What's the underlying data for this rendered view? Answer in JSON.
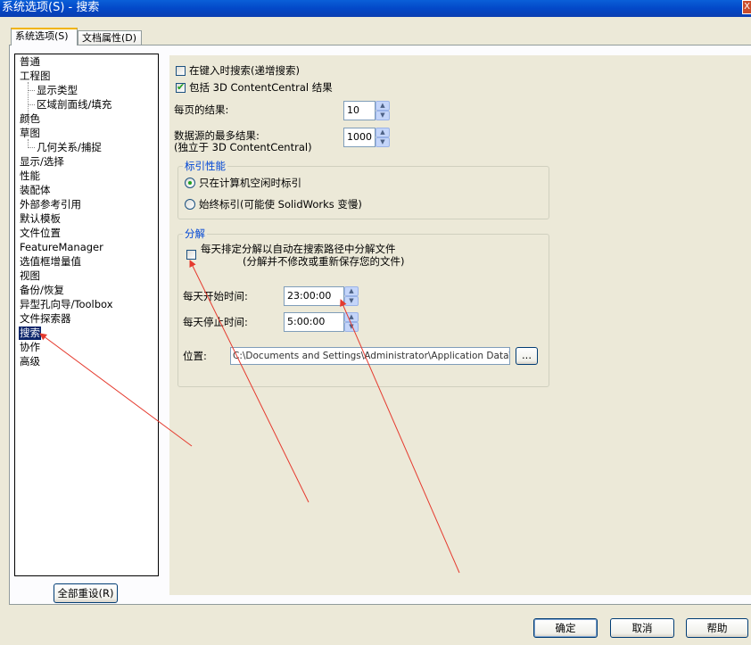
{
  "window": {
    "title": "系统选项(S) - 搜索",
    "close_glyph": "X"
  },
  "tabs": [
    {
      "label": "系统选项(S)"
    },
    {
      "label": "文档属性(D)"
    }
  ],
  "tree": {
    "items": [
      {
        "label": "普通"
      },
      {
        "label": "工程图"
      },
      {
        "label": "显示类型"
      },
      {
        "label": "区域剖面线/填充"
      },
      {
        "label": "颜色"
      },
      {
        "label": "草图"
      },
      {
        "label": "几何关系/捕捉"
      },
      {
        "label": "显示/选择"
      },
      {
        "label": "性能"
      },
      {
        "label": "装配体"
      },
      {
        "label": "外部参考引用"
      },
      {
        "label": "默认模板"
      },
      {
        "label": "文件位置"
      },
      {
        "label": "FeatureManager"
      },
      {
        "label": "选值框增量值"
      },
      {
        "label": "视图"
      },
      {
        "label": "备份/恢复"
      },
      {
        "label": "异型孔向导/Toolbox"
      },
      {
        "label": "文件探索器"
      },
      {
        "label": "搜索"
      },
      {
        "label": "协作"
      },
      {
        "label": "高级"
      }
    ],
    "reset_button": "全部重设(R)"
  },
  "search": {
    "incremental_label": "在键入时搜索(递增搜索)",
    "incremental_checked": false,
    "include_3d_label": "包括 3D ContentCentral 结果",
    "include_3d_checked": true,
    "results_per_page_label": "每页的结果:",
    "results_per_page_value": "10",
    "max_results_label_1": "数据源的最多结果:",
    "max_results_label_2": "(独立于 3D ContentCentral)",
    "max_results_value": "1000"
  },
  "indexing": {
    "title": "标引性能",
    "option_idle": "只在计算机空闲时标引",
    "option_always": "始终标引(可能使 SolidWorks 变慢)",
    "selected": "idle"
  },
  "dissection": {
    "title": "分解",
    "schedule_label_1": "每天排定分解以自动在搜索路径中分解文件",
    "schedule_label_2": "(分解并不修改或重新保存您的文件)",
    "schedule_checked": false,
    "start_label": "每天开始时间:",
    "start_value": "23:00:00",
    "stop_label": "每天停止时间:",
    "stop_value": "5:00:00",
    "location_label": "位置:",
    "location_value": "C:\\Documents and Settings\\Administrator\\Application Data\\Solid\\",
    "browse_label": "..."
  },
  "buttons": {
    "ok": "确定",
    "cancel": "取消",
    "help": "帮助"
  },
  "colors": {
    "annotation_arrow": "#E53A2E",
    "selection": "#0A246A",
    "group_title": "#0046D5"
  }
}
